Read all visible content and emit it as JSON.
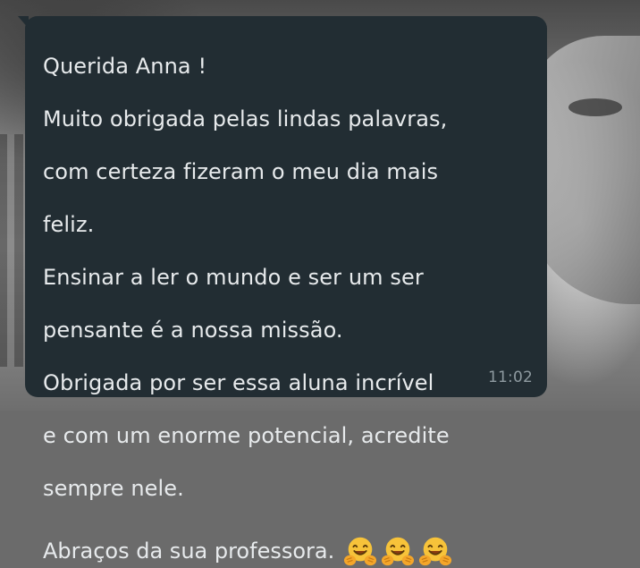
{
  "message": {
    "lines": [
      "Querida Anna !",
      "Muito obrigada pelas lindas palavras,",
      "com certeza fizeram o meu dia mais",
      "feliz.",
      "Ensinar a ler o mundo e ser um ser",
      "pensante é a nossa missão.",
      "Obrigada por ser essa aluna incrível",
      "e com um enorme potencial, acredite",
      "sempre nele."
    ],
    "closing": "Abraços da sua professora.",
    "emojis": [
      "hugging-face-emoji",
      "hugging-face-emoji",
      "hugging-face-emoji"
    ],
    "time": "11:02"
  },
  "colors": {
    "bubble": "#222d33",
    "text": "#e7eaec",
    "timestamp": "#8e9aa0",
    "emoji_face": "#f7c33a"
  }
}
